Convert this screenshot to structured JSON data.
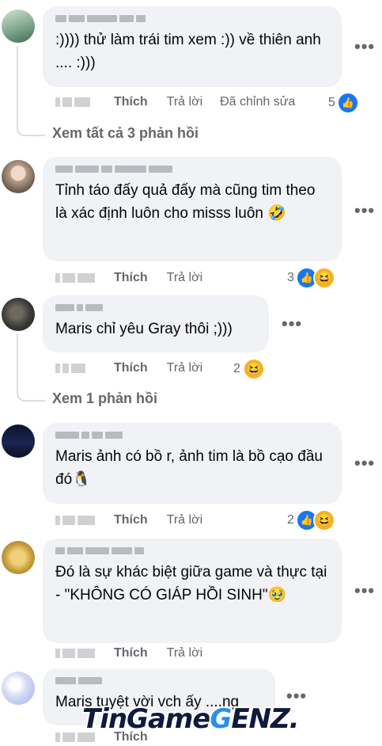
{
  "comments": [
    {
      "text": ":)))) thử làm trái tim xem :)) về thiên anh .... :)))",
      "like": "Thích",
      "reply": "Trả lời",
      "edited": "Đã chỉnh sửa",
      "reaction_count": "5",
      "view_replies": "Xem tất cả 3 phản hồi"
    },
    {
      "text": "Tỉnh táo đấy quả đấy mà cũng tim theo là xác định luôn cho misss luôn 🤣",
      "like": "Thích",
      "reply": "Trả lời",
      "reaction_count": "3"
    },
    {
      "text": "Maris chỉ yêu Gray thôi ;)))",
      "like": "Thích",
      "reply": "Trả lời",
      "reaction_count": "2",
      "view_replies": "Xem 1 phản hồi"
    },
    {
      "text": "Maris ảnh có bồ r, ảnh tim là bồ cạo đầu đó🐧",
      "like": "Thích",
      "reply": "Trả lời",
      "reaction_count": "2"
    },
    {
      "text": "Đó là sự khác biệt giữa game và thực tại - \"KHÔNG CÓ GIÁP HỒI SINH\"🥹",
      "like": "Thích",
      "reply": "Trả lời"
    },
    {
      "text": "Maris tuyệt vời vch ấy ....ng",
      "like": "Thích"
    }
  ],
  "more_icon": "•••",
  "watermark": {
    "part1": "TinGame",
    "part2": "G",
    "part3": "ENZ."
  },
  "icons": {
    "like": "like-icon",
    "haha": "haha-icon",
    "more": "more-options-icon"
  }
}
